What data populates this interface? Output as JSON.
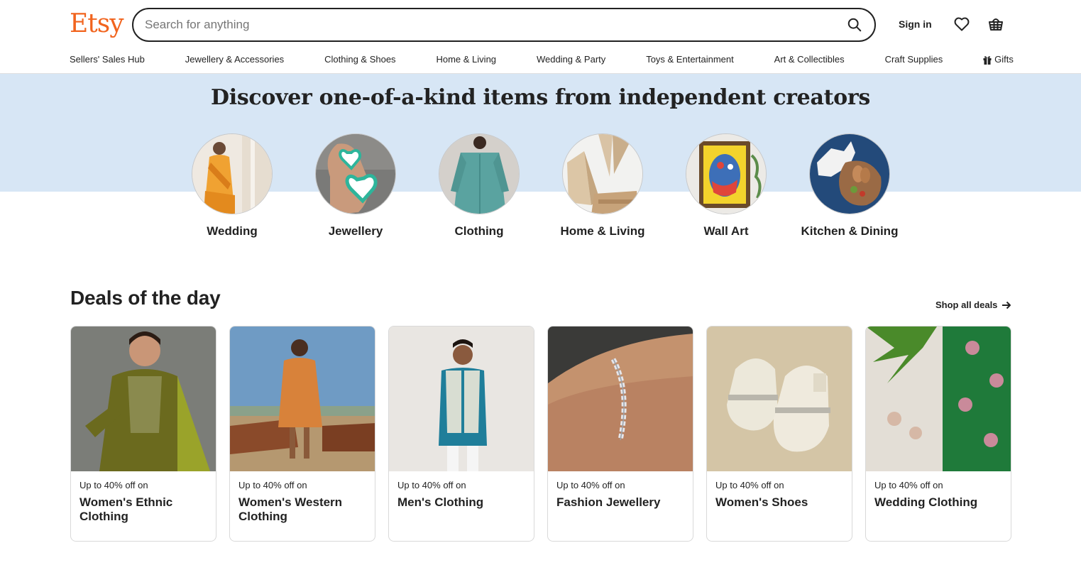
{
  "brand": {
    "logo_text": "Etsy",
    "accent": "#F1641E"
  },
  "search": {
    "placeholder": "Search for anything",
    "value": ""
  },
  "header": {
    "signin_label": "Sign in"
  },
  "nav": {
    "items": [
      "Sellers' Sales Hub",
      "Jewellery & Accessories",
      "Clothing & Shoes",
      "Home & Living",
      "Wedding & Party",
      "Toys & Entertainment",
      "Art & Collectibles",
      "Craft Supplies",
      "Gifts"
    ]
  },
  "hero": {
    "title": "Discover one-of-a-kind items from independent creators",
    "band_color": "#D7E6F5",
    "categories": [
      {
        "label": "Wedding"
      },
      {
        "label": "Jewellery"
      },
      {
        "label": "Clothing"
      },
      {
        "label": "Home & Living"
      },
      {
        "label": "Wall Art"
      },
      {
        "label": "Kitchen & Dining"
      }
    ]
  },
  "deals": {
    "title": "Deals of the day",
    "shop_all_label": "Shop all deals",
    "cards": [
      {
        "pre": "Up to 40% off on",
        "title": "Women's Ethnic Clothing"
      },
      {
        "pre": "Up to 40% off on",
        "title": "Women's Western Clothing"
      },
      {
        "pre": "Up to 40% off on",
        "title": "Men's Clothing"
      },
      {
        "pre": "Up to 40% off on",
        "title": "Fashion Jewellery"
      },
      {
        "pre": "Up to 40% off on",
        "title": "Women's Shoes"
      },
      {
        "pre": "Up to 40% off on",
        "title": "Wedding Clothing"
      }
    ]
  }
}
